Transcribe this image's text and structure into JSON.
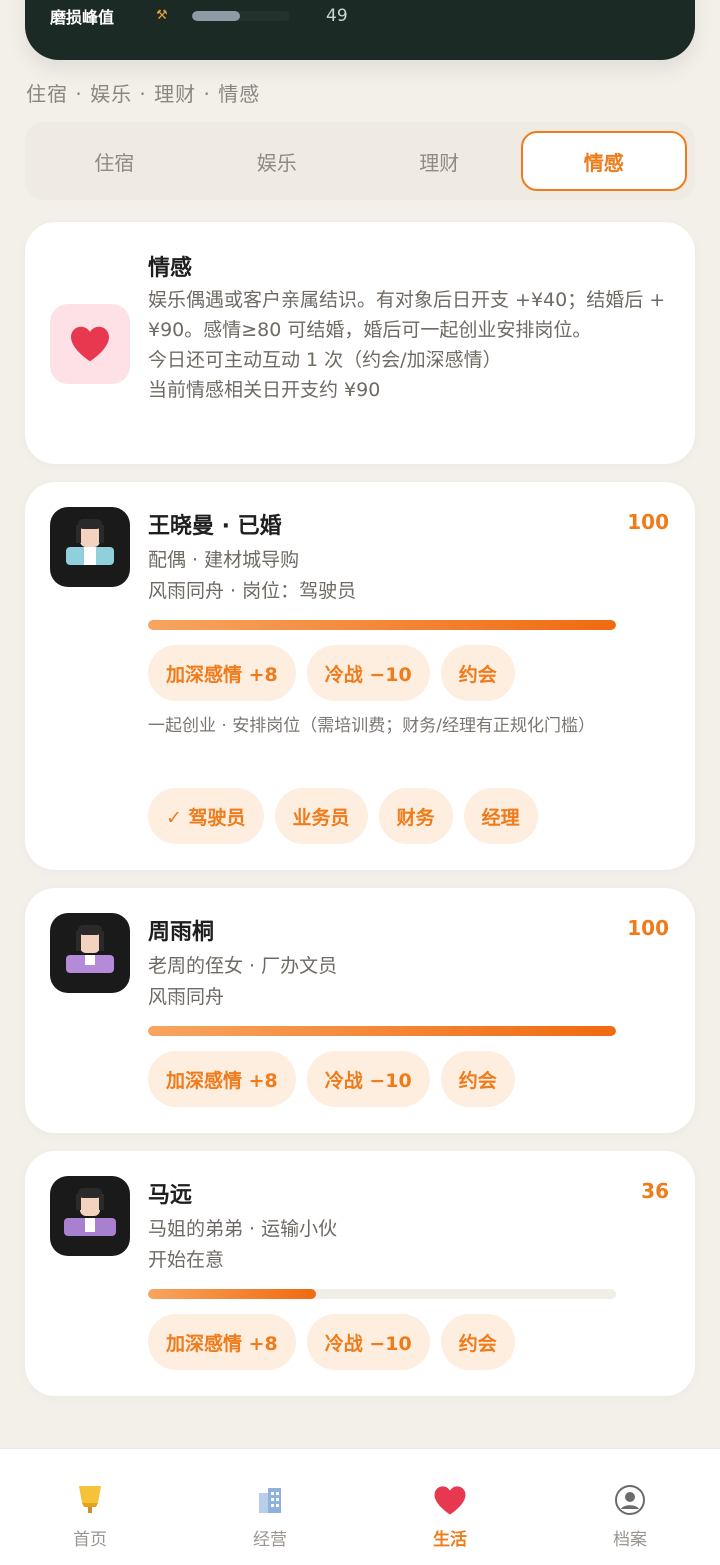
{
  "header": {
    "wear_label": "磨损峰值",
    "wear_value": "49",
    "wear_fraction": 0.49
  },
  "breadcrumb": "住宿 · 娱乐 · 理财 · 情感",
  "tabs": [
    {
      "label": "住宿",
      "active": false
    },
    {
      "label": "娱乐",
      "active": false
    },
    {
      "label": "理财",
      "active": false
    },
    {
      "label": "情感",
      "active": true
    }
  ],
  "info": {
    "title": "情感",
    "line1": "娱乐偶遇或客户亲属结识。有对象后日开支 +¥40；结婚后 +¥90。感情≥80 可结婚，婚后可一起创业安排岗位。",
    "line2": "今日还可主动互动 1 次（约会/加深感情）",
    "line3": "当前情感相关日开支约 ¥90",
    "icon": "heart-icon"
  },
  "people": [
    {
      "name": "王晓曼 · 已婚",
      "score": "100",
      "affection": 1.0,
      "sub1": "配偶 · 建材城导购",
      "sub2": "风雨同舟 · 岗位：驾驶员",
      "actions": [
        "加深感情 +8",
        "冷战 −10",
        "约会"
      ],
      "note": "一起创业 · 安排岗位（需培训费；财务/经理有正规化门槛）",
      "jobs": [
        "✓ 驾驶员",
        "业务员",
        "财务",
        "经理"
      ]
    },
    {
      "name": "周雨桐",
      "score": "100",
      "affection": 1.0,
      "sub1": "老周的侄女 · 厂办文员",
      "sub2": "风雨同舟",
      "actions": [
        "加深感情 +8",
        "冷战 −10",
        "约会"
      ]
    },
    {
      "name": "马远",
      "score": "36",
      "affection": 0.36,
      "sub1": "马姐的弟弟 · 运输小伙",
      "sub2": "开始在意",
      "actions": [
        "加深感情 +8",
        "冷战 −10",
        "约会"
      ]
    }
  ],
  "nav": [
    {
      "label": "首页",
      "icon": "home-icon",
      "active": false
    },
    {
      "label": "经营",
      "icon": "building-icon",
      "active": false
    },
    {
      "label": "生活",
      "icon": "heart-icon",
      "active": true
    },
    {
      "label": "档案",
      "icon": "profile-icon",
      "active": false
    }
  ],
  "colors": {
    "accent": "#f07b1a",
    "banner": "#1b2a24",
    "heart": "#e8384f"
  }
}
